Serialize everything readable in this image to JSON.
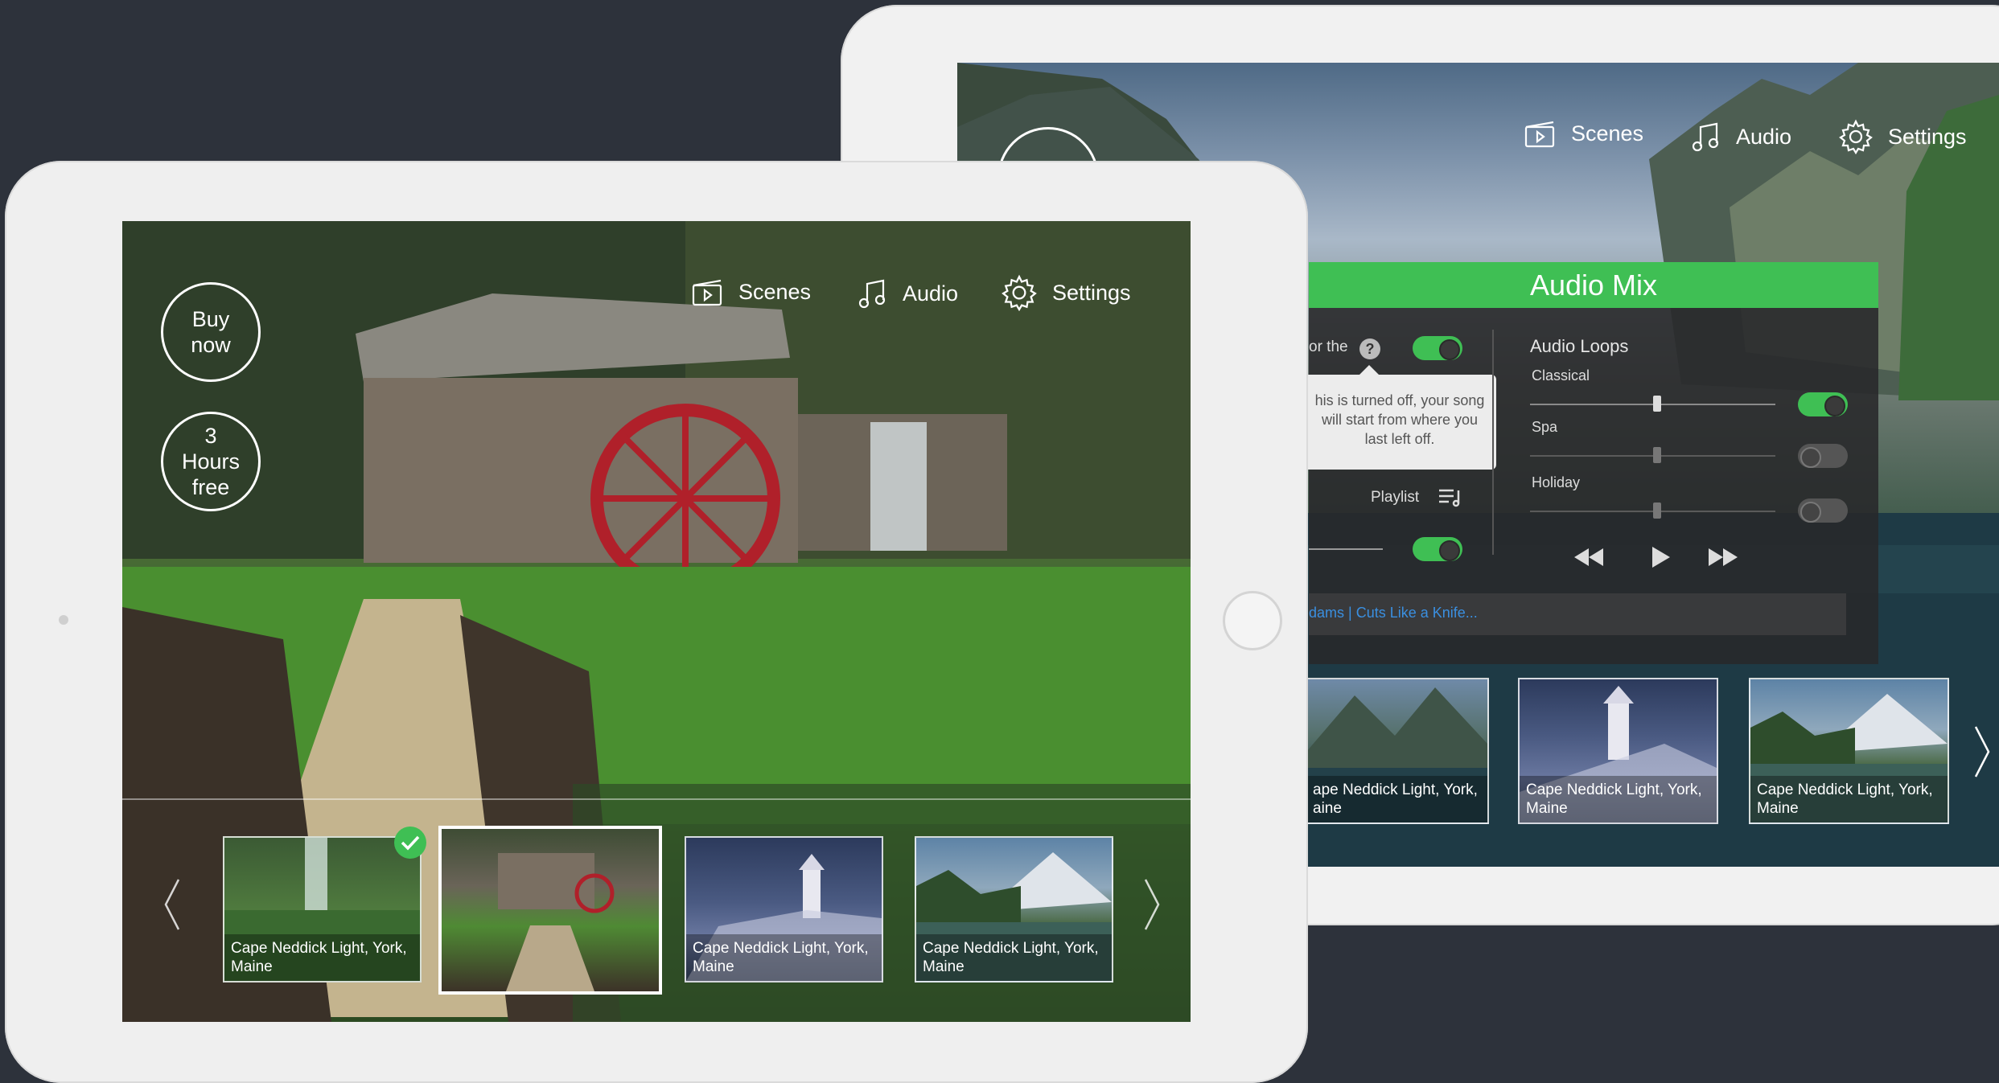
{
  "back_app": {
    "nav": {
      "scenes": "Scenes",
      "audio": "Audio",
      "settings": "Settings"
    },
    "audio_mix": {
      "title": "Audio Mix",
      "help_label_partial": "or the",
      "tooltip_lines": [
        "his is turned off, your song",
        "will start from where you",
        "last left off."
      ],
      "playlist_label": "Playlist",
      "now_playing": "dams | Cuts Like a Knife...",
      "loops_title": "Audio Loops",
      "loops": [
        {
          "name": "Classical",
          "level": 0.5,
          "enabled": true
        },
        {
          "name": "Spa",
          "level": 0.5,
          "enabled": false
        },
        {
          "name": "Holiday",
          "level": 0.5,
          "enabled": false
        }
      ],
      "toggles": {
        "help_toggle": true,
        "playlist_toggle": true
      }
    },
    "thumbnails": [
      {
        "caption": "ape Neddick Light, York,\naine"
      },
      {
        "caption": "Cape Neddick Light, York, Maine"
      },
      {
        "caption": "Cape Neddick Light, York, Maine"
      }
    ]
  },
  "front_app": {
    "nav": {
      "scenes": "Scenes",
      "audio": "Audio",
      "settings": "Settings"
    },
    "buy_now": "Buy now",
    "hours_free": "3 Hours free",
    "thumbnails": [
      {
        "caption": "Cape Neddick Light, York, Maine",
        "checked": true
      },
      {
        "caption": "",
        "selected": true
      },
      {
        "caption": "Cape Neddick Light, York, Maine"
      },
      {
        "caption": "Cape Neddick Light, York, Maine"
      }
    ]
  },
  "colors": {
    "accent": "#3fbf54",
    "background": "#2d323b",
    "link": "#3a8fe0"
  }
}
